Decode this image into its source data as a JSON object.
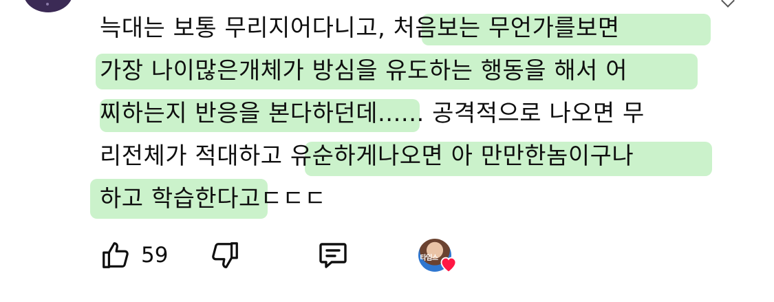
{
  "comment": {
    "lines": [
      {
        "before": "늑대는 보통 무리지어다니고, ",
        "highlight": "처음보는 무언가를보면",
        "after": ""
      },
      {
        "before": "",
        "highlight": "가장 나이많은개체가 방심을 유도하는 행동을 해서 어",
        "after": ""
      },
      {
        "before": "",
        "highlight": "찌하는지 반응을 본다하던데",
        "after": "...... 공격적으로 나오면 무"
      },
      {
        "before": "리전체가 적대하고 ",
        "highlight": "유순하게나오면 아 만만한놈이구나",
        "after": ""
      },
      {
        "before": "",
        "highlight": "하고 학습한다고",
        "after": "ㄷㄷㄷ"
      }
    ],
    "highlight_color": "#a0e8a0"
  },
  "actions": {
    "like_count": "59",
    "creator_label": "타임스"
  },
  "icons": {
    "like": "thumbs-up-icon",
    "dislike": "thumbs-down-icon",
    "reply": "reply-comment-icon",
    "creator_heart": "heart-icon"
  }
}
